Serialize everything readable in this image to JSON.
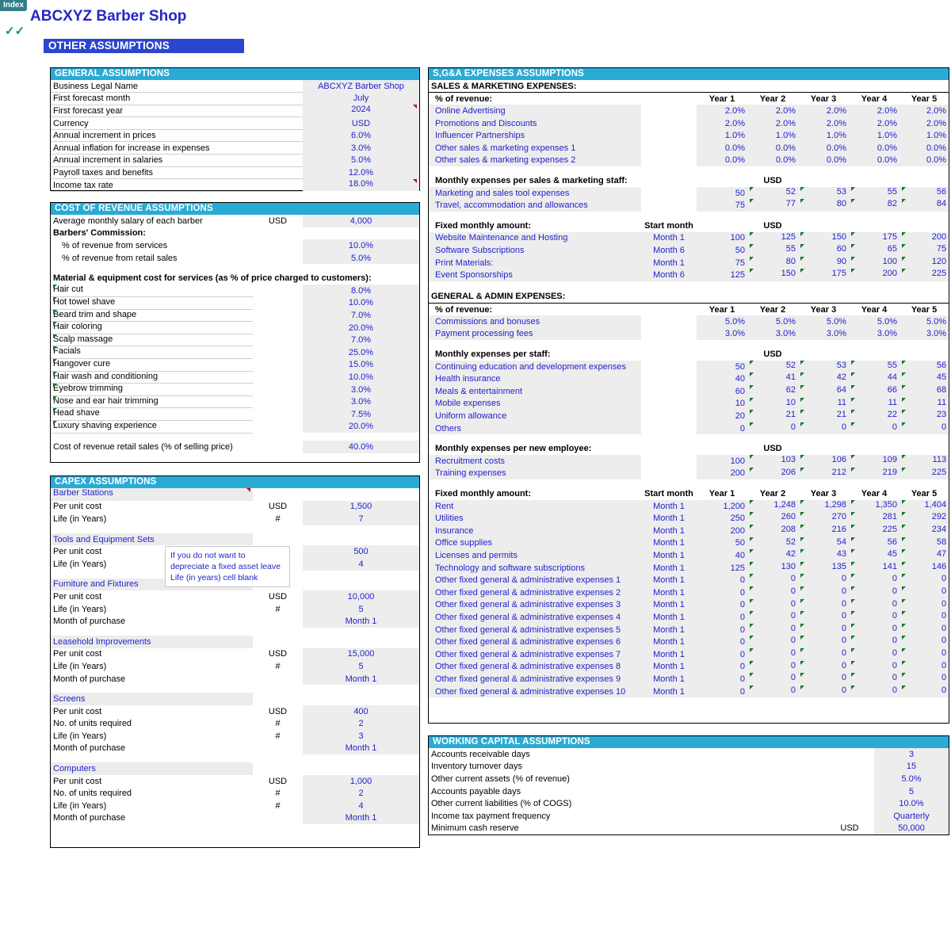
{
  "window": {
    "index_tab": "Index",
    "checkmarks": "✓✓",
    "app_title": "ABCXYZ Barber Shop",
    "page_banner": "OTHER ASSUMPTIONS"
  },
  "general": {
    "header": "GENERAL ASSUMPTIONS",
    "rows": [
      {
        "label": "Business Legal Name",
        "value": "ABCXYZ Barber Shop",
        "comment": false
      },
      {
        "label": "First forecast month",
        "value": "July",
        "comment": false
      },
      {
        "label": "First forecast year",
        "value": "2024",
        "comment": true
      },
      {
        "label": "Currency",
        "value": "USD",
        "comment": false
      },
      {
        "label": "Annual increment in prices",
        "value": "6.0%",
        "comment": false
      },
      {
        "label": "Annual inflation for increase in expenses",
        "value": "3.0%",
        "comment": false
      },
      {
        "label": "Annual increment in salaries",
        "value": "5.0%",
        "comment": false
      },
      {
        "label": "Payroll taxes and benefits",
        "value": "12.0%",
        "comment": false
      },
      {
        "label": "Income tax rate",
        "value": "18.0%",
        "comment": true
      }
    ]
  },
  "cost_of_revenue": {
    "header": "COST OF REVENUE ASSUMPTIONS",
    "salary_label": "Average monthly salary of each barber",
    "salary_unit": "USD",
    "salary_value": "4,000",
    "commission_header": "Barbers' Commission:",
    "commission_rows": [
      {
        "label": "% of revenue from services",
        "value": "10.0%"
      },
      {
        "label": "% of revenue from retail sales",
        "value": "5.0%"
      }
    ],
    "material_header": "Material & equipment cost for services (as % of price charged to customers):",
    "services": [
      {
        "label": "Hair cut",
        "value": "8.0%"
      },
      {
        "label": "Hot towel shave",
        "value": "10.0%"
      },
      {
        "label": "Beard trim and shape",
        "value": "7.0%"
      },
      {
        "label": "Hair coloring",
        "value": "20.0%"
      },
      {
        "label": "Scalp massage",
        "value": "7.0%"
      },
      {
        "label": "Facials",
        "value": "25.0%"
      },
      {
        "label": "Hangover cure",
        "value": "15.0%"
      },
      {
        "label": "Hair wash and conditioning",
        "value": "10.0%"
      },
      {
        "label": "Eyebrow trimming",
        "value": "3.0%"
      },
      {
        "label": "Nose and ear hair trimming",
        "value": "3.0%"
      },
      {
        "label": "Head shave",
        "value": "7.5%"
      },
      {
        "label": "Luxury shaving experience",
        "value": "20.0%"
      }
    ],
    "retail_label": "Cost of revenue retail sales (% of selling price)",
    "retail_value": "40.0%"
  },
  "capex": {
    "header": "CAPEX ASSUMPTIONS",
    "note": "If you do not want to depreciate a fixed asset leave Life (in years) cell blank",
    "groups": [
      {
        "name": "Barber Stations",
        "comment": true,
        "rows": [
          {
            "label": "Per unit cost",
            "unit": "USD",
            "value": "1,500"
          },
          {
            "label": "Life (in Years)",
            "unit": "#",
            "value": "7"
          }
        ]
      },
      {
        "name": "Tools and Equipment Sets",
        "comment": false,
        "rows": [
          {
            "label": "Per unit cost",
            "unit": "USD",
            "value": "500"
          },
          {
            "label": "Life (in Years)",
            "unit": "#",
            "value": "4"
          }
        ]
      },
      {
        "name": "Furniture and Fixtures",
        "comment": false,
        "rows": [
          {
            "label": "Per unit cost",
            "unit": "USD",
            "value": "10,000"
          },
          {
            "label": "Life (in Years)",
            "unit": "#",
            "value": "5"
          },
          {
            "label": "Month of purchase",
            "unit": "",
            "value": "Month 1"
          }
        ]
      },
      {
        "name": "Leasehold Improvements",
        "comment": false,
        "rows": [
          {
            "label": "Per unit cost",
            "unit": "USD",
            "value": "15,000"
          },
          {
            "label": "Life (in Years)",
            "unit": "#",
            "value": "5"
          },
          {
            "label": "Month of purchase",
            "unit": "",
            "value": "Month 1"
          }
        ]
      },
      {
        "name": "Screens",
        "comment": false,
        "rows": [
          {
            "label": "Per unit cost",
            "unit": "USD",
            "value": "400"
          },
          {
            "label": "No. of units required",
            "unit": "#",
            "value": "2"
          },
          {
            "label": "Life (in Years)",
            "unit": "#",
            "value": "3"
          },
          {
            "label": "Month of purchase",
            "unit": "",
            "value": "Month 1"
          }
        ]
      },
      {
        "name": "Computers",
        "comment": false,
        "rows": [
          {
            "label": "Per unit cost",
            "unit": "USD",
            "value": "1,000"
          },
          {
            "label": "No. of units required",
            "unit": "#",
            "value": "2"
          },
          {
            "label": "Life (in Years)",
            "unit": "#",
            "value": "4"
          },
          {
            "label": "Month of purchase",
            "unit": "",
            "value": "Month 1"
          }
        ]
      }
    ]
  },
  "sga": {
    "header": "S,G&A EXPENSES ASSUMPTIONS",
    "year_cols": [
      "Year 1",
      "Year 2",
      "Year 3",
      "Year 4",
      "Year 5"
    ],
    "usd_label": "USD",
    "start_month_label": "Start month",
    "sales_marketing_header": "SALES & MARKETING EXPENSES:",
    "pct_revenue_label": "% of revenue:",
    "sm_pct_rows": [
      {
        "label": "Online Advertising",
        "values": [
          "2.0%",
          "2.0%",
          "2.0%",
          "2.0%",
          "2.0%"
        ]
      },
      {
        "label": "Promotions and Discounts",
        "values": [
          "2.0%",
          "2.0%",
          "2.0%",
          "2.0%",
          "2.0%"
        ]
      },
      {
        "label": "Influencer Partnerships",
        "values": [
          "1.0%",
          "1.0%",
          "1.0%",
          "1.0%",
          "1.0%"
        ]
      },
      {
        "label": "Other sales & marketing expenses 1",
        "values": [
          "0.0%",
          "0.0%",
          "0.0%",
          "0.0%",
          "0.0%"
        ]
      },
      {
        "label": "Other sales & marketing expenses 2",
        "values": [
          "0.0%",
          "0.0%",
          "0.0%",
          "0.0%",
          "0.0%"
        ]
      }
    ],
    "sm_per_staff_label": "Monthly expenses per sales & marketing staff:",
    "sm_per_staff_rows": [
      {
        "label": "Marketing and sales tool expenses",
        "values": [
          "50",
          "52",
          "53",
          "55",
          "56"
        ]
      },
      {
        "label": "Travel, accommodation and allowances",
        "values": [
          "75",
          "77",
          "80",
          "82",
          "84"
        ]
      }
    ],
    "sm_fixed_label": "Fixed monthly amount:",
    "sm_fixed_rows": [
      {
        "label": "Website Maintenance and Hosting",
        "start": "Month 1",
        "values": [
          "100",
          "125",
          "150",
          "175",
          "200"
        ]
      },
      {
        "label": "Software Subscriptions",
        "start": "Month 6",
        "values": [
          "50",
          "55",
          "60",
          "65",
          "75"
        ]
      },
      {
        "label": "Print Materials:",
        "start": "Month 1",
        "values": [
          "75",
          "80",
          "90",
          "100",
          "120"
        ]
      },
      {
        "label": "Event Sponsorships",
        "start": "Month 6",
        "values": [
          "125",
          "150",
          "175",
          "200",
          "225"
        ]
      }
    ],
    "ga_header": "GENERAL & ADMIN EXPENSES:",
    "ga_pct_rows": [
      {
        "label": "Commissions and bonuses",
        "values": [
          "5.0%",
          "5.0%",
          "5.0%",
          "5.0%",
          "5.0%"
        ]
      },
      {
        "label": "Payment processing fees",
        "values": [
          "3.0%",
          "3.0%",
          "3.0%",
          "3.0%",
          "3.0%"
        ]
      }
    ],
    "ga_per_staff_label": "Monthly expenses per staff:",
    "ga_per_staff_rows": [
      {
        "label": "Continuing education and development expenses",
        "values": [
          "50",
          "52",
          "53",
          "55",
          "56"
        ]
      },
      {
        "label": "Health insurance",
        "values": [
          "40",
          "41",
          "42",
          "44",
          "45"
        ]
      },
      {
        "label": "Meals & entertainment",
        "values": [
          "60",
          "62",
          "64",
          "66",
          "68"
        ]
      },
      {
        "label": "Mobile expenses",
        "values": [
          "10",
          "10",
          "11",
          "11",
          "11"
        ]
      },
      {
        "label": "Uniform allowance",
        "values": [
          "20",
          "21",
          "21",
          "22",
          "23"
        ]
      },
      {
        "label": "Others",
        "values": [
          "0",
          "0",
          "0",
          "0",
          "0"
        ]
      }
    ],
    "ga_per_new_employee_label": "Monthly expenses per new employee:",
    "ga_per_new_employee_rows": [
      {
        "label": "Recruitment costs",
        "values": [
          "100",
          "103",
          "106",
          "109",
          "113"
        ]
      },
      {
        "label": "Training expenses",
        "values": [
          "200",
          "206",
          "212",
          "219",
          "225"
        ]
      }
    ],
    "ga_fixed_label": "Fixed monthly amount:",
    "ga_fixed_rows": [
      {
        "label": "Rent",
        "start": "Month 1",
        "values": [
          "1,200",
          "1,248",
          "1,298",
          "1,350",
          "1,404"
        ]
      },
      {
        "label": "Utilities",
        "start": "Month 1",
        "values": [
          "250",
          "260",
          "270",
          "281",
          "292"
        ]
      },
      {
        "label": "Insurance",
        "start": "Month 1",
        "values": [
          "200",
          "208",
          "216",
          "225",
          "234"
        ]
      },
      {
        "label": "Office supplies",
        "start": "Month 1",
        "values": [
          "50",
          "52",
          "54",
          "56",
          "58"
        ]
      },
      {
        "label": "Licenses and permits",
        "start": "Month 1",
        "values": [
          "40",
          "42",
          "43",
          "45",
          "47"
        ]
      },
      {
        "label": "Technology and software subscriptions",
        "start": "Month 1",
        "values": [
          "125",
          "130",
          "135",
          "141",
          "146"
        ]
      },
      {
        "label": "Other fixed general & administrative expenses 1",
        "start": "Month 1",
        "values": [
          "0",
          "0",
          "0",
          "0",
          "0"
        ]
      },
      {
        "label": "Other fixed general & administrative expenses 2",
        "start": "Month 1",
        "values": [
          "0",
          "0",
          "0",
          "0",
          "0"
        ]
      },
      {
        "label": "Other fixed general & administrative expenses 3",
        "start": "Month 1",
        "values": [
          "0",
          "0",
          "0",
          "0",
          "0"
        ]
      },
      {
        "label": "Other fixed general & administrative expenses 4",
        "start": "Month 1",
        "values": [
          "0",
          "0",
          "0",
          "0",
          "0"
        ]
      },
      {
        "label": "Other fixed general & administrative expenses 5",
        "start": "Month 1",
        "values": [
          "0",
          "0",
          "0",
          "0",
          "0"
        ]
      },
      {
        "label": "Other fixed general & administrative expenses 6",
        "start": "Month 1",
        "values": [
          "0",
          "0",
          "0",
          "0",
          "0"
        ]
      },
      {
        "label": "Other fixed general & administrative expenses 7",
        "start": "Month 1",
        "values": [
          "0",
          "0",
          "0",
          "0",
          "0"
        ]
      },
      {
        "label": "Other fixed general & administrative expenses 8",
        "start": "Month 1",
        "values": [
          "0",
          "0",
          "0",
          "0",
          "0"
        ]
      },
      {
        "label": "Other fixed general & administrative expenses 9",
        "start": "Month 1",
        "values": [
          "0",
          "0",
          "0",
          "0",
          "0"
        ]
      },
      {
        "label": "Other fixed general & administrative expenses 10",
        "start": "Month 1",
        "values": [
          "0",
          "0",
          "0",
          "0",
          "0"
        ]
      }
    ]
  },
  "working_capital": {
    "header": "WORKING CAPITAL ASSUMPTIONS",
    "rows": [
      {
        "label": "Accounts receivable days",
        "unit": "",
        "value": "3"
      },
      {
        "label": "Inventory turnover days",
        "unit": "",
        "value": "15"
      },
      {
        "label": "Other current assets (% of revenue)",
        "unit": "",
        "value": "5.0%"
      },
      {
        "label": "Accounts payable days",
        "unit": "",
        "value": "5"
      },
      {
        "label": "Other current liabilities (% of COGS)",
        "unit": "",
        "value": "10.0%"
      },
      {
        "label": "Income tax payment frequency",
        "unit": "",
        "value": "Quarterly"
      },
      {
        "label": "Minimum cash reserve",
        "unit": "USD",
        "value": "50,000"
      }
    ]
  },
  "colors": {
    "accent_header": "#29ABD6",
    "banner": "#2b45cf",
    "value_text": "#2222cc",
    "input_fill": "#ededed",
    "index_tab": "#2e7f8b",
    "tick": "#179c3f"
  }
}
